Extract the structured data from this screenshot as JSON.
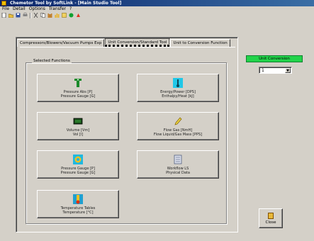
{
  "window": {
    "title": "Chemetor Tool by SoftLink - [Main Studio Tool]"
  },
  "menu": [
    "File",
    "Detail",
    "Options",
    "Transfer",
    "?"
  ],
  "tabs": [
    {
      "label": "Compressors/Blowers/Vacuum Pumps Exp",
      "active": false
    },
    {
      "label": "Unit Conversion/Standard Tool",
      "active": true
    },
    {
      "label": "Unit to Conversion Function",
      "active": false
    }
  ],
  "group": {
    "label": "Selected Functions"
  },
  "buttons": [
    {
      "line1": "Pressure Abs [P]",
      "line2": "Pressure Gauge [G]",
      "icon": "gauge-icon",
      "color": "#1a8a2a"
    },
    {
      "line1": "Energy/Power [DPS]",
      "line2": "Enthalpy/Heat [kJ]",
      "icon": "thermometer-icon",
      "color": "#20c8e8"
    },
    {
      "line1": "Volume [Vm]",
      "line2": "Vol [l]",
      "icon": "monitor-icon",
      "color": "#1a4a1a"
    },
    {
      "line1": "Flow Gas [NmH]",
      "line2": "Flow Liquid/Gas Mass [PPS]",
      "icon": "pencil-icon",
      "color": "#e8d040"
    },
    {
      "line1": "Pressure Gauge [P]",
      "line2": "Pressure Gauge [G]",
      "icon": "gear-icon",
      "color": "#f0c020"
    },
    {
      "line1": "Workflow LS",
      "line2": "Physical Data",
      "icon": "document-icon",
      "color": "#a0a8c0"
    },
    {
      "line1": "Temperature Tables",
      "line2": "Temperature [°C]",
      "icon": "temperature-icon",
      "color": "#e03010"
    }
  ],
  "units": {
    "label": "Unit Conversion",
    "value": "1"
  },
  "exit": {
    "label": "Close"
  }
}
